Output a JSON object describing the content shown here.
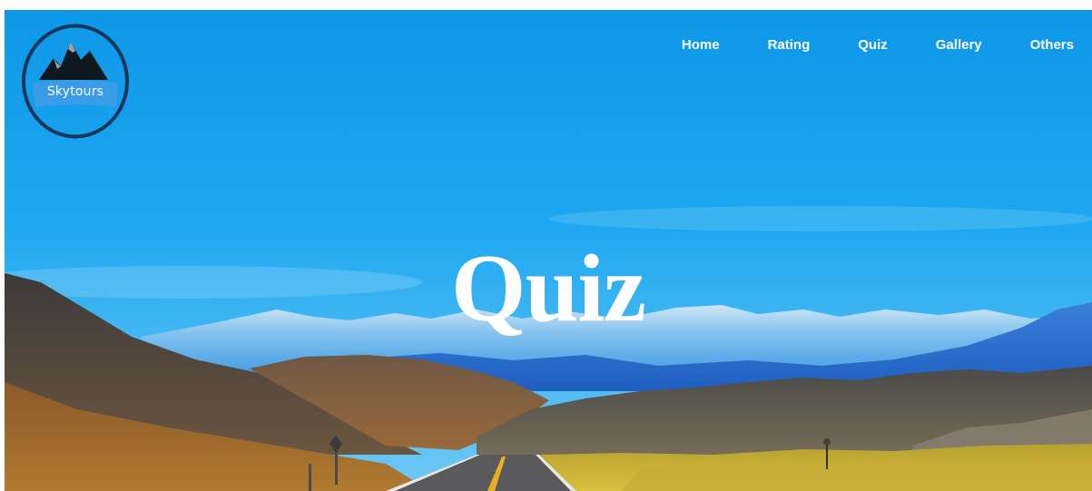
{
  "brand": {
    "name": "Skytours"
  },
  "nav": {
    "items": [
      {
        "label": "Home"
      },
      {
        "label": "Rating"
      },
      {
        "label": "Quiz"
      },
      {
        "label": "Gallery"
      },
      {
        "label": "Others"
      }
    ]
  },
  "hero": {
    "title": "Quiz"
  },
  "colors": {
    "sky": "#1aa3ee",
    "nav_text": "#ffffff",
    "logo_ring": "#17365c",
    "logo_fill": "#3a9be6"
  }
}
